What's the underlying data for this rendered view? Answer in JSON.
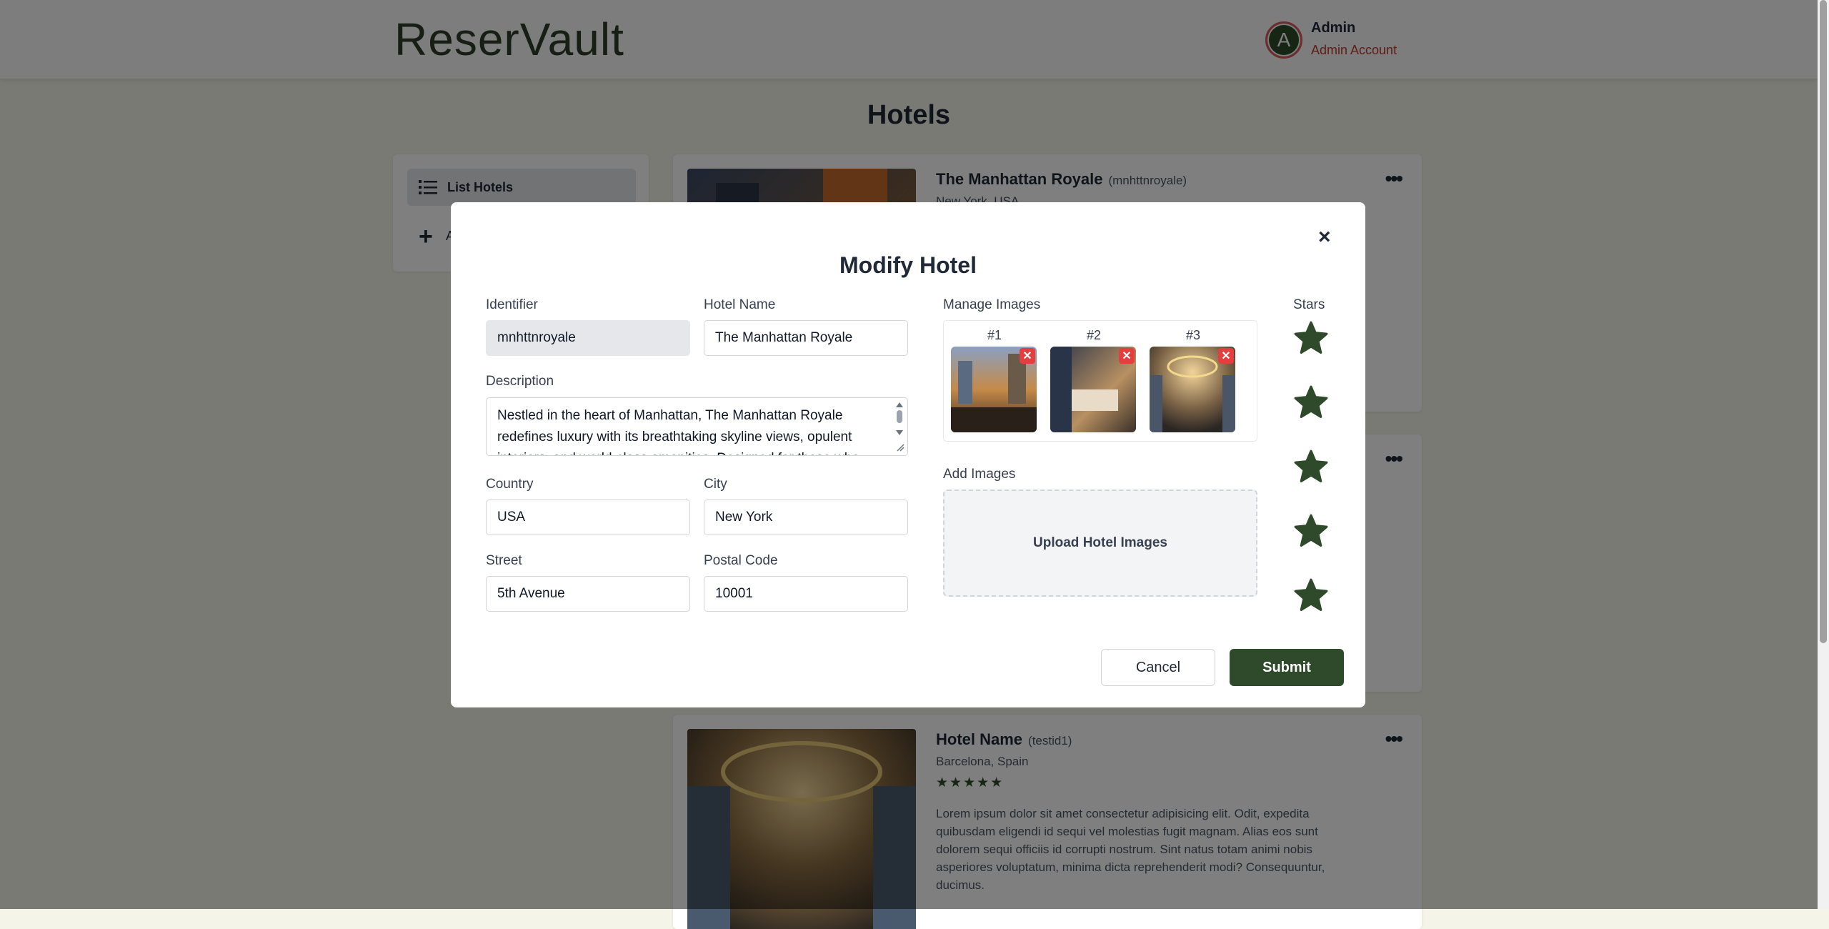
{
  "header": {
    "brand": "ReserVault",
    "avatar_letter": "A",
    "user_name": "Admin",
    "user_role": "Admin Account"
  },
  "page": {
    "title": "Hotels"
  },
  "sidebar": {
    "items": [
      {
        "label": "List Hotels",
        "icon": "list-icon",
        "active": true
      },
      {
        "label": "A",
        "icon": "plus-icon",
        "active": false
      }
    ]
  },
  "cards": [
    {
      "name": "The Manhattan Royale",
      "identifier": "(mnhttnroyale)",
      "location": "New York, USA"
    },
    {
      "name": "",
      "identifier": "",
      "location": ""
    },
    {
      "name": "Hotel Name",
      "identifier": "(testid1)",
      "location": "Barcelona, Spain",
      "stars": "★★★★★",
      "description": "Lorem ipsum dolor sit amet consectetur adipisicing elit. Odit, expedita quibusdam eligendi id sequi vel molestias fugit magnam. Alias eos sunt dolorem sequi officiis id corrupti nostrum. Sint natus totam animi nobis asperiores voluptatum, minima dicta reprehenderit modi? Consequuntur, ducimus."
    }
  ],
  "modal": {
    "title": "Modify Hotel",
    "close": "×",
    "identifier_label": "Identifier",
    "identifier_value": "mnhttnroyale",
    "hotel_name_label": "Hotel Name",
    "hotel_name_value": "The Manhattan Royale",
    "description_label": "Description",
    "description_value": "Nestled in the heart of Manhattan, The Manhattan Royale redefines luxury with its breathtaking skyline views, opulent interiors, and world-class amenities. Designed for those who",
    "country_label": "Country",
    "country_value": "USA",
    "city_label": "City",
    "city_value": "New York",
    "street_label": "Street",
    "street_value": "5th Avenue",
    "postal_label": "Postal Code",
    "postal_value": "10001",
    "manage_images_label": "Manage Images",
    "images": [
      {
        "num": "#1",
        "remove": "✕"
      },
      {
        "num": "#2",
        "remove": "✕"
      },
      {
        "num": "#3",
        "remove": "✕"
      }
    ],
    "add_images_label": "Add Images",
    "upload_label": "Upload Hotel Images",
    "stars_label": "Stars",
    "stars_rating": 5,
    "cancel_label": "Cancel",
    "submit_label": "Submit"
  },
  "colors": {
    "accent": "#2f4a2a",
    "danger": "#e53e3e",
    "background": "#f4f4e9"
  }
}
